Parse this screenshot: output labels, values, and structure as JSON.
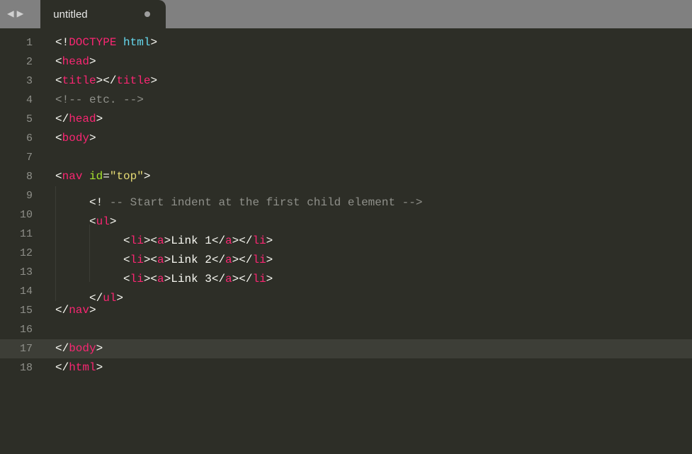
{
  "tab": {
    "title": "untitled",
    "dirty": true
  },
  "activeLine": 17,
  "lines": [
    {
      "n": 1,
      "tokens": [
        {
          "t": "punc",
          "v": "<!"
        },
        {
          "t": "doctype-kw",
          "v": "DOCTYPE"
        },
        {
          "t": "punc",
          "v": " "
        },
        {
          "t": "doctype-val",
          "v": "html"
        },
        {
          "t": "punc",
          "v": ">"
        }
      ]
    },
    {
      "n": 2,
      "tokens": [
        {
          "t": "punc",
          "v": "<"
        },
        {
          "t": "tag",
          "v": "head"
        },
        {
          "t": "punc",
          "v": ">"
        }
      ]
    },
    {
      "n": 3,
      "tokens": [
        {
          "t": "punc",
          "v": "<"
        },
        {
          "t": "tag",
          "v": "title"
        },
        {
          "t": "punc",
          "v": "></"
        },
        {
          "t": "tag",
          "v": "title"
        },
        {
          "t": "punc",
          "v": ">"
        }
      ]
    },
    {
      "n": 4,
      "tokens": [
        {
          "t": "comment",
          "v": "<!-- etc. -->"
        }
      ]
    },
    {
      "n": 5,
      "tokens": [
        {
          "t": "punc",
          "v": "</"
        },
        {
          "t": "tag",
          "v": "head"
        },
        {
          "t": "punc",
          "v": ">"
        }
      ]
    },
    {
      "n": 6,
      "tokens": [
        {
          "t": "punc",
          "v": "<"
        },
        {
          "t": "tag",
          "v": "body"
        },
        {
          "t": "punc",
          "v": ">"
        }
      ]
    },
    {
      "n": 7,
      "tokens": []
    },
    {
      "n": 8,
      "tokens": [
        {
          "t": "punc",
          "v": "<"
        },
        {
          "t": "tag",
          "v": "nav"
        },
        {
          "t": "punc",
          "v": " "
        },
        {
          "t": "attr-name",
          "v": "id"
        },
        {
          "t": "punc",
          "v": "="
        },
        {
          "t": "attr-val",
          "v": "\"top\""
        },
        {
          "t": "punc",
          "v": ">"
        }
      ]
    },
    {
      "n": 9,
      "indent": 1,
      "tokens": [
        {
          "t": "punc",
          "v": "<! "
        },
        {
          "t": "comment",
          "v": "-- Start indent at the first child element -->"
        }
      ]
    },
    {
      "n": 10,
      "indent": 1,
      "tokens": [
        {
          "t": "punc",
          "v": "<"
        },
        {
          "t": "tag",
          "v": "ul"
        },
        {
          "t": "punc",
          "v": ">"
        }
      ]
    },
    {
      "n": 11,
      "indent": 2,
      "tokens": [
        {
          "t": "punc",
          "v": "<"
        },
        {
          "t": "tag",
          "v": "li"
        },
        {
          "t": "punc",
          "v": "><"
        },
        {
          "t": "tag",
          "v": "a"
        },
        {
          "t": "punc",
          "v": ">"
        },
        {
          "t": "text",
          "v": "Link 1"
        },
        {
          "t": "punc",
          "v": "</"
        },
        {
          "t": "tag",
          "v": "a"
        },
        {
          "t": "punc",
          "v": "></"
        },
        {
          "t": "tag",
          "v": "li"
        },
        {
          "t": "punc",
          "v": ">"
        }
      ]
    },
    {
      "n": 12,
      "indent": 2,
      "tokens": [
        {
          "t": "punc",
          "v": "<"
        },
        {
          "t": "tag",
          "v": "li"
        },
        {
          "t": "punc",
          "v": "><"
        },
        {
          "t": "tag",
          "v": "a"
        },
        {
          "t": "punc",
          "v": ">"
        },
        {
          "t": "text",
          "v": "Link 2"
        },
        {
          "t": "punc",
          "v": "</"
        },
        {
          "t": "tag",
          "v": "a"
        },
        {
          "t": "punc",
          "v": "></"
        },
        {
          "t": "tag",
          "v": "li"
        },
        {
          "t": "punc",
          "v": ">"
        }
      ]
    },
    {
      "n": 13,
      "indent": 2,
      "tokens": [
        {
          "t": "punc",
          "v": "<"
        },
        {
          "t": "tag",
          "v": "li"
        },
        {
          "t": "punc",
          "v": "><"
        },
        {
          "t": "tag",
          "v": "a"
        },
        {
          "t": "punc",
          "v": ">"
        },
        {
          "t": "text",
          "v": "Link 3"
        },
        {
          "t": "punc",
          "v": "</"
        },
        {
          "t": "tag",
          "v": "a"
        },
        {
          "t": "punc",
          "v": "></"
        },
        {
          "t": "tag",
          "v": "li"
        },
        {
          "t": "punc",
          "v": ">"
        }
      ]
    },
    {
      "n": 14,
      "indent": 1,
      "tokens": [
        {
          "t": "punc",
          "v": "</"
        },
        {
          "t": "tag",
          "v": "ul"
        },
        {
          "t": "punc",
          "v": ">"
        }
      ]
    },
    {
      "n": 15,
      "tokens": [
        {
          "t": "punc",
          "v": "</"
        },
        {
          "t": "tag",
          "v": "nav"
        },
        {
          "t": "punc",
          "v": ">"
        }
      ]
    },
    {
      "n": 16,
      "tokens": []
    },
    {
      "n": 17,
      "tokens": [
        {
          "t": "punc",
          "v": "</"
        },
        {
          "t": "tag",
          "v": "body"
        },
        {
          "t": "punc",
          "v": ">"
        }
      ]
    },
    {
      "n": 18,
      "tokens": [
        {
          "t": "punc",
          "v": "</"
        },
        {
          "t": "tag",
          "v": "html"
        },
        {
          "t": "punc",
          "v": ">"
        }
      ]
    }
  ]
}
